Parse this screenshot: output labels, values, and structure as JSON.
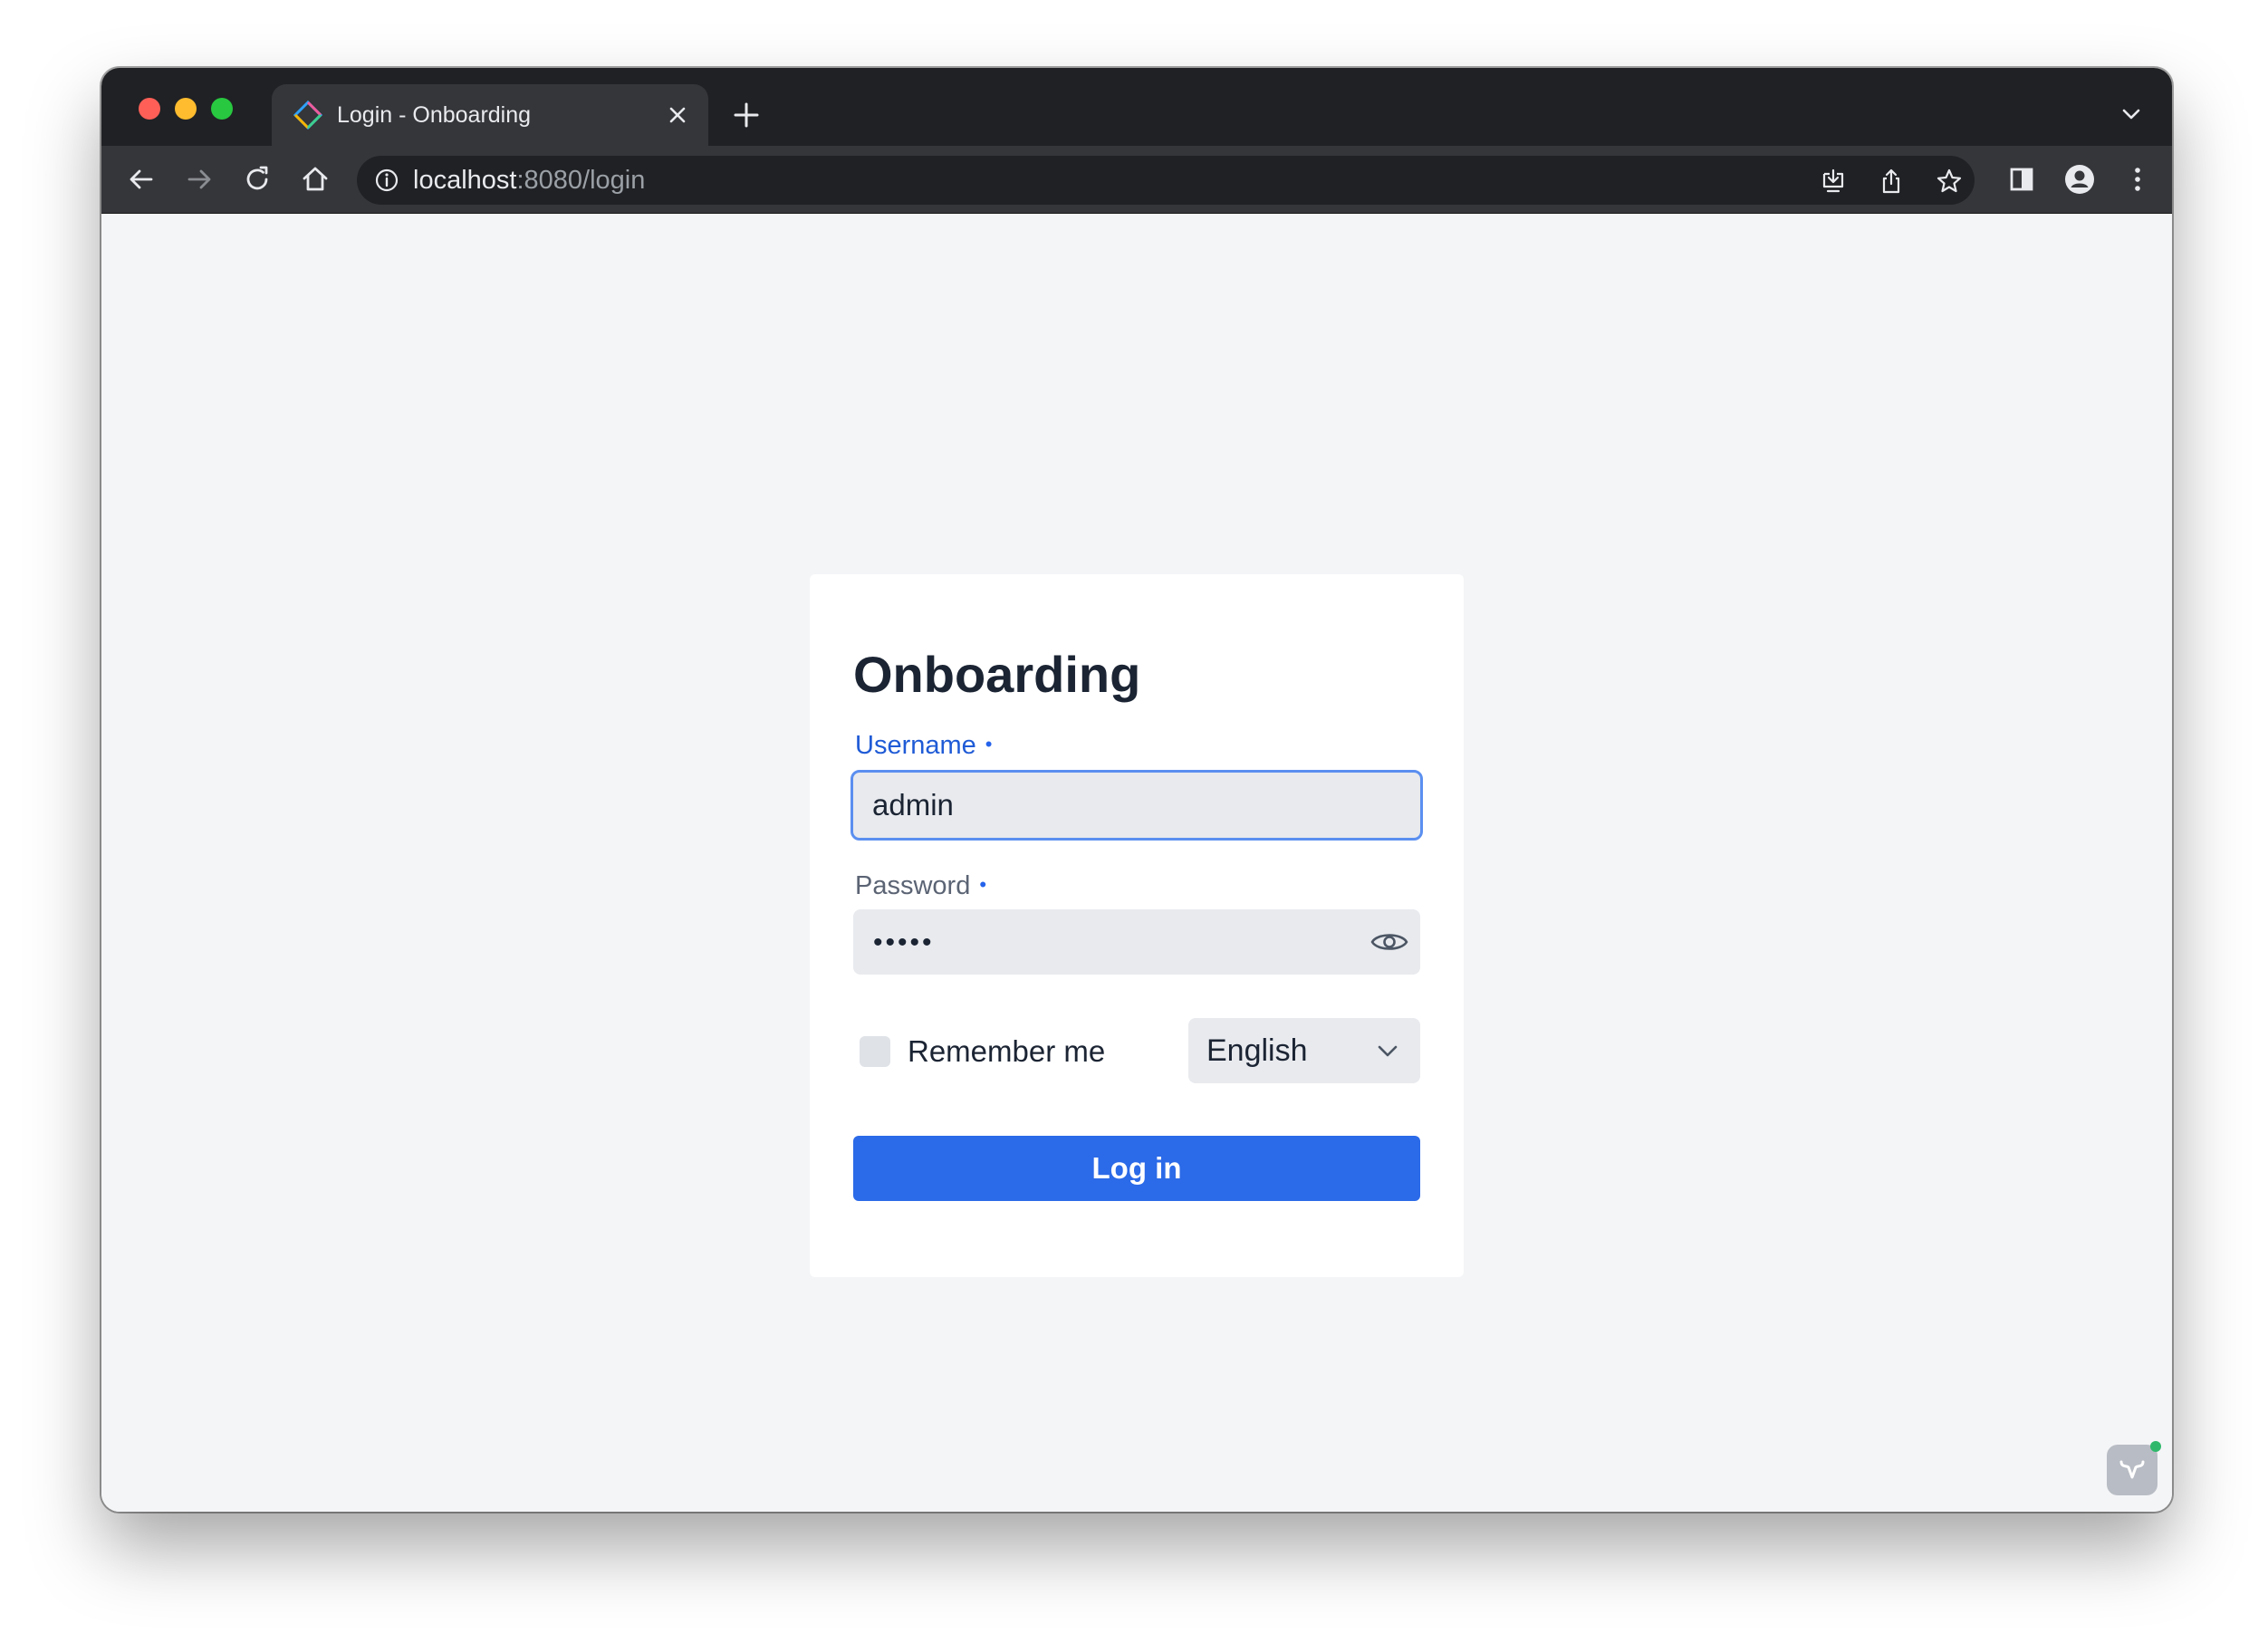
{
  "browser": {
    "tab": {
      "title": "Login - Onboarding",
      "favicon": "vaadin-logo-icon"
    },
    "address_bar": {
      "host": "localhost",
      "rest": ":8080/login"
    },
    "colors": {
      "frame": "#202124",
      "toolbar": "#35363a"
    }
  },
  "login_form": {
    "title": "Onboarding",
    "username": {
      "label": "Username",
      "required_indicator": "•",
      "value": "admin"
    },
    "password": {
      "label": "Password",
      "required_indicator": "•",
      "masked_value": "•••••"
    },
    "remember_me": {
      "label": "Remember me",
      "checked": false
    },
    "language": {
      "selected": "English"
    },
    "submit_label": "Log in",
    "colors": {
      "primary": "#2b6ae8",
      "focused_label": "#1f5bd6",
      "field_background": "#e8eaee"
    }
  }
}
